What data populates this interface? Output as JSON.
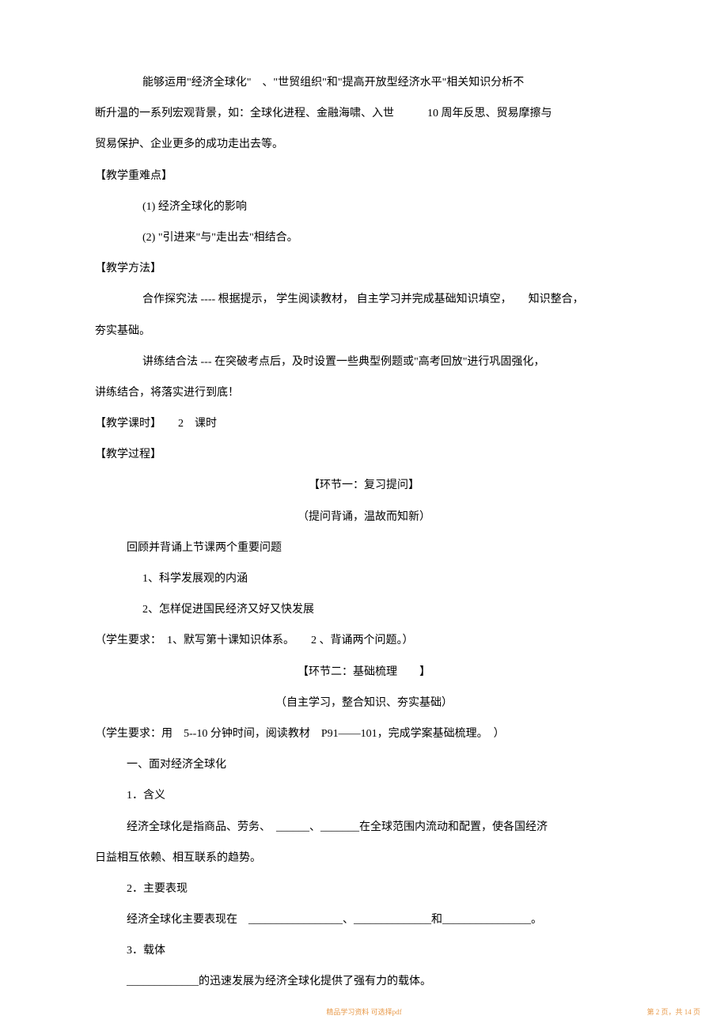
{
  "p1": "能够运用\"经济全球化\"　、\"世贸组织\"和\"提高开放型经济水平\"相关知识分析不",
  "p2": "断升温的一系列宏观背景，如：全球化进程、金融海啸、入世　　　10 周年反思、贸易摩擦与",
  "p3": "贸易保护、企业更多的成功走出去等。",
  "h1": "【教学重难点】",
  "p4": "(1) 经济全球化的影响",
  "p5": "(2) \"引进来\"与\"走出去\"相结合。",
  "h2": "【教学方法】",
  "p6": "合作探究法  ----  根据提示，  学生阅读教材，  自主学习并完成基础知识填空，　　知识整合，",
  "p7": "夯实基础。",
  "p8": "讲练结合法  --- 在突破考点后，及时设置一些典型例题或\"高考回放\"进行巩固强化，",
  "p9": "讲练结合，将落实进行到底！",
  "h3": "【教学课时】　　2　课时",
  "h4": "【教学过程】",
  "c1": "【环节一：复习提问】",
  "c2": "（提问背诵，温故而知新）",
  "p10": "回顾并背诵上节课两个重要问题",
  "p11": "1、科学发展观的内涵",
  "p12": "2、怎样促进国民经济又好又快发展",
  "p13": "（学生要求：　1、默写第十课知识体系。　　2 、背诵两个问题。）",
  "c3": "【环节二：基础梳理　　】",
  "c4": "（自主学习，整合知识、夯实基础）",
  "p14": "（学生要求：用　5--10  分钟时间，阅读教材　P91——101，完成学案基础梳理。　）",
  "p15": "一、面对经济全球化",
  "p16": "1．含义",
  "p17": "经济全球化是指商品、劳务、　______、_______在全球范围内流动和配置，使各国经济",
  "p18": "日益相互依赖、相互联系的趋势。",
  "p19": "2．主要表现",
  "p20": "经济全球化主要表现在　_________________、______________和________________。",
  "p21": "3．载体",
  "p22": "_____________的迅速发展为经济全球化提供了强有力的载体。",
  "footer_center": "精品学习资料    可选择pdf",
  "footer_right": "第 2 页，共 14 页"
}
